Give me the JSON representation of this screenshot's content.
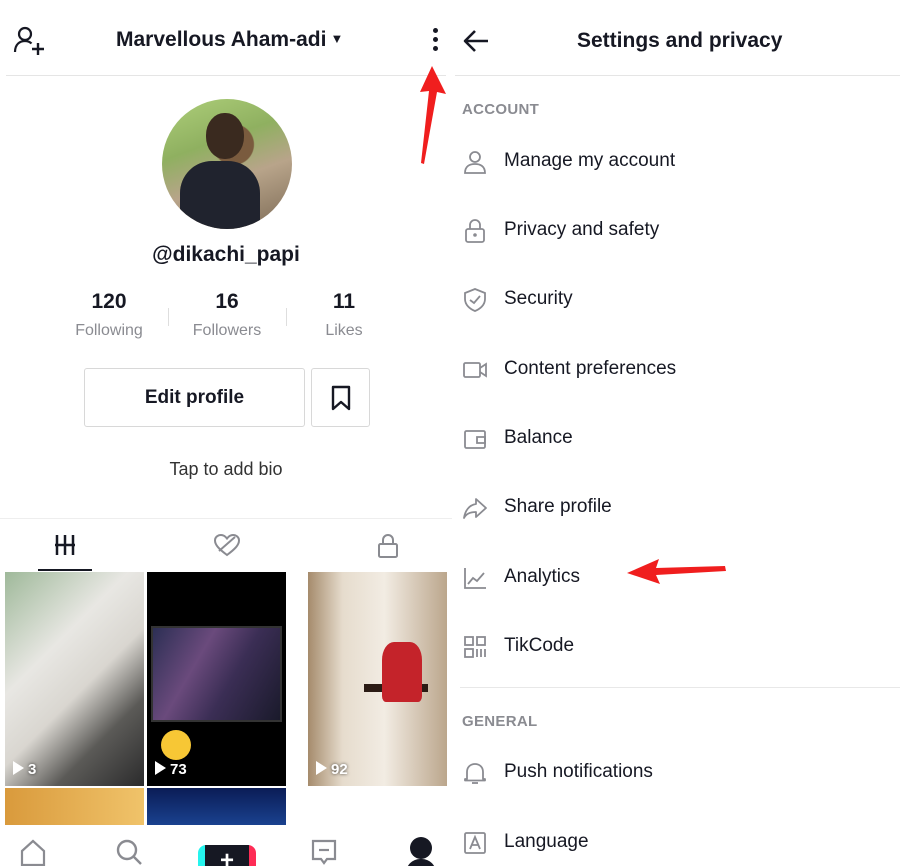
{
  "profile": {
    "username": "Marvellous Aham-adi",
    "handle": "@dikachi_papi",
    "stats": [
      {
        "value": "120",
        "label": "Following"
      },
      {
        "value": "16",
        "label": "Followers"
      },
      {
        "value": "11",
        "label": "Likes"
      }
    ],
    "edit_profile_label": "Edit profile",
    "bio_prompt": "Tap to add bio",
    "videos": [
      {
        "views": "3"
      },
      {
        "views": "73"
      },
      {
        "views": "92"
      }
    ]
  },
  "settings": {
    "title": "Settings and privacy",
    "account_section": "ACCOUNT",
    "account_items": [
      {
        "label": "Manage my account",
        "icon": "person-icon"
      },
      {
        "label": "Privacy and safety",
        "icon": "lock-icon"
      },
      {
        "label": "Security",
        "icon": "shield-icon"
      },
      {
        "label": "Content preferences",
        "icon": "video-camera-icon"
      },
      {
        "label": "Balance",
        "icon": "wallet-icon"
      },
      {
        "label": "Share profile",
        "icon": "share-icon"
      },
      {
        "label": "Analytics",
        "icon": "analytics-chart-icon"
      },
      {
        "label": "TikCode",
        "icon": "qr-code-icon"
      }
    ],
    "general_section": "GENERAL",
    "general_items": [
      {
        "label": "Push notifications",
        "icon": "bell-icon"
      },
      {
        "label": "Language",
        "icon": "language-icon"
      }
    ]
  },
  "colors": {
    "annotation_arrow": "#f01e1e",
    "text": "#161823",
    "muted": "#8a8b91"
  }
}
